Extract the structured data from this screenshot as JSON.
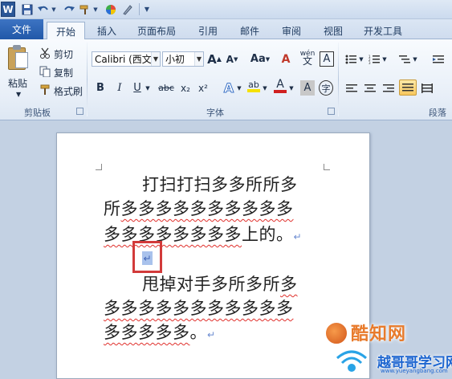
{
  "qat": {
    "app_icon": "W",
    "save_icon": "floppy-disk-icon",
    "undo_icon": "undo-icon",
    "redo_icon": "redo-icon",
    "format_painter_icon": "brush-icon",
    "color_icon": "color-wheel-icon",
    "draw_icon": "pen-icon",
    "customize_icon": "customize-arrow-icon"
  },
  "tabs": {
    "file": "文件",
    "home": "开始",
    "insert": "插入",
    "page_layout": "页面布局",
    "references": "引用",
    "mailings": "邮件",
    "review": "审阅",
    "view": "视图",
    "developer": "开发工具"
  },
  "clipboard": {
    "paste": "粘贴",
    "cut": "剪切",
    "copy": "复制",
    "format_painter": "格式刷",
    "group_label": "剪贴板"
  },
  "font": {
    "font_name": "Calibri (西文i",
    "font_size": "小初",
    "grow": "A",
    "shrink": "A",
    "change_case": "Aa",
    "clear_format": "A",
    "phonetic": "wén",
    "border_char": "A",
    "bold": "B",
    "italic": "I",
    "underline": "U",
    "strikethrough": "abc",
    "subscript": "x₂",
    "superscript": "x²",
    "text_effects": "A",
    "highlight": "ab",
    "font_color": "A",
    "shade": "A",
    "enclose": "字",
    "group_label": "字体",
    "font_color_hex": "#d02020",
    "highlight_hex": "#f5e100"
  },
  "paragraph": {
    "group_label": "段落"
  },
  "document": {
    "para1_line1": "打扫打扫多多所所多",
    "para1_line2_first": "所",
    "para1_line2_rest": "多多多多多多多多多多",
    "para1_line3_squig": "多多多多多多多多",
    "para1_line3_end": "上的。",
    "para2_line1_lead": "甩掉对手多所多所",
    "para2_line1_end": "多",
    "para2_line2": "多多多多多多多多多多多",
    "para2_line3_squig": "多多多多多",
    "para2_line3_end": "。",
    "paragraph_mark": "↵"
  },
  "watermarks": {
    "site1": "酷知网",
    "site2": "越哥哥学习网",
    "site2_url": "www.yueyangbang.com"
  }
}
